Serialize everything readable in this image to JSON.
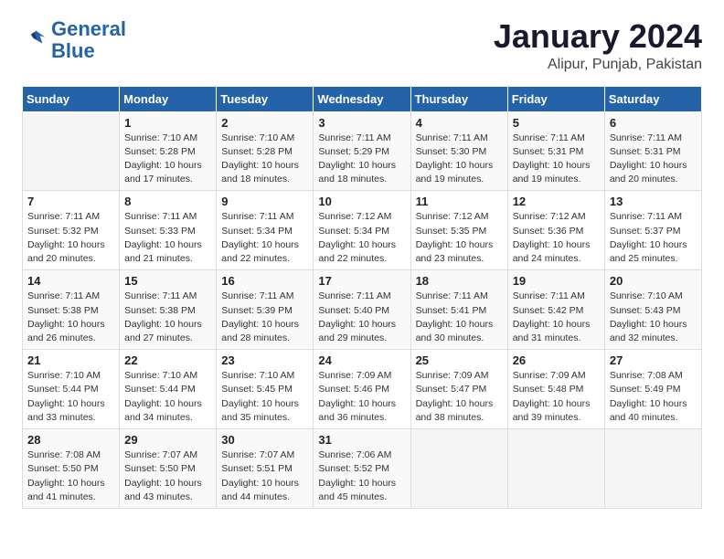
{
  "header": {
    "logo_line1": "General",
    "logo_line2": "Blue",
    "title": "January 2024",
    "subtitle": "Alipur, Punjab, Pakistan"
  },
  "weekdays": [
    "Sunday",
    "Monday",
    "Tuesday",
    "Wednesday",
    "Thursday",
    "Friday",
    "Saturday"
  ],
  "weeks": [
    [
      {
        "day": "",
        "sunrise": "",
        "sunset": "",
        "daylight": ""
      },
      {
        "day": "1",
        "sunrise": "Sunrise: 7:10 AM",
        "sunset": "Sunset: 5:28 PM",
        "daylight": "Daylight: 10 hours and 17 minutes."
      },
      {
        "day": "2",
        "sunrise": "Sunrise: 7:10 AM",
        "sunset": "Sunset: 5:28 PM",
        "daylight": "Daylight: 10 hours and 18 minutes."
      },
      {
        "day": "3",
        "sunrise": "Sunrise: 7:11 AM",
        "sunset": "Sunset: 5:29 PM",
        "daylight": "Daylight: 10 hours and 18 minutes."
      },
      {
        "day": "4",
        "sunrise": "Sunrise: 7:11 AM",
        "sunset": "Sunset: 5:30 PM",
        "daylight": "Daylight: 10 hours and 19 minutes."
      },
      {
        "day": "5",
        "sunrise": "Sunrise: 7:11 AM",
        "sunset": "Sunset: 5:31 PM",
        "daylight": "Daylight: 10 hours and 19 minutes."
      },
      {
        "day": "6",
        "sunrise": "Sunrise: 7:11 AM",
        "sunset": "Sunset: 5:31 PM",
        "daylight": "Daylight: 10 hours and 20 minutes."
      }
    ],
    [
      {
        "day": "7",
        "sunrise": "Sunrise: 7:11 AM",
        "sunset": "Sunset: 5:32 PM",
        "daylight": "Daylight: 10 hours and 20 minutes."
      },
      {
        "day": "8",
        "sunrise": "Sunrise: 7:11 AM",
        "sunset": "Sunset: 5:33 PM",
        "daylight": "Daylight: 10 hours and 21 minutes."
      },
      {
        "day": "9",
        "sunrise": "Sunrise: 7:11 AM",
        "sunset": "Sunset: 5:34 PM",
        "daylight": "Daylight: 10 hours and 22 minutes."
      },
      {
        "day": "10",
        "sunrise": "Sunrise: 7:12 AM",
        "sunset": "Sunset: 5:34 PM",
        "daylight": "Daylight: 10 hours and 22 minutes."
      },
      {
        "day": "11",
        "sunrise": "Sunrise: 7:12 AM",
        "sunset": "Sunset: 5:35 PM",
        "daylight": "Daylight: 10 hours and 23 minutes."
      },
      {
        "day": "12",
        "sunrise": "Sunrise: 7:12 AM",
        "sunset": "Sunset: 5:36 PM",
        "daylight": "Daylight: 10 hours and 24 minutes."
      },
      {
        "day": "13",
        "sunrise": "Sunrise: 7:11 AM",
        "sunset": "Sunset: 5:37 PM",
        "daylight": "Daylight: 10 hours and 25 minutes."
      }
    ],
    [
      {
        "day": "14",
        "sunrise": "Sunrise: 7:11 AM",
        "sunset": "Sunset: 5:38 PM",
        "daylight": "Daylight: 10 hours and 26 minutes."
      },
      {
        "day": "15",
        "sunrise": "Sunrise: 7:11 AM",
        "sunset": "Sunset: 5:38 PM",
        "daylight": "Daylight: 10 hours and 27 minutes."
      },
      {
        "day": "16",
        "sunrise": "Sunrise: 7:11 AM",
        "sunset": "Sunset: 5:39 PM",
        "daylight": "Daylight: 10 hours and 28 minutes."
      },
      {
        "day": "17",
        "sunrise": "Sunrise: 7:11 AM",
        "sunset": "Sunset: 5:40 PM",
        "daylight": "Daylight: 10 hours and 29 minutes."
      },
      {
        "day": "18",
        "sunrise": "Sunrise: 7:11 AM",
        "sunset": "Sunset: 5:41 PM",
        "daylight": "Daylight: 10 hours and 30 minutes."
      },
      {
        "day": "19",
        "sunrise": "Sunrise: 7:11 AM",
        "sunset": "Sunset: 5:42 PM",
        "daylight": "Daylight: 10 hours and 31 minutes."
      },
      {
        "day": "20",
        "sunrise": "Sunrise: 7:10 AM",
        "sunset": "Sunset: 5:43 PM",
        "daylight": "Daylight: 10 hours and 32 minutes."
      }
    ],
    [
      {
        "day": "21",
        "sunrise": "Sunrise: 7:10 AM",
        "sunset": "Sunset: 5:44 PM",
        "daylight": "Daylight: 10 hours and 33 minutes."
      },
      {
        "day": "22",
        "sunrise": "Sunrise: 7:10 AM",
        "sunset": "Sunset: 5:44 PM",
        "daylight": "Daylight: 10 hours and 34 minutes."
      },
      {
        "day": "23",
        "sunrise": "Sunrise: 7:10 AM",
        "sunset": "Sunset: 5:45 PM",
        "daylight": "Daylight: 10 hours and 35 minutes."
      },
      {
        "day": "24",
        "sunrise": "Sunrise: 7:09 AM",
        "sunset": "Sunset: 5:46 PM",
        "daylight": "Daylight: 10 hours and 36 minutes."
      },
      {
        "day": "25",
        "sunrise": "Sunrise: 7:09 AM",
        "sunset": "Sunset: 5:47 PM",
        "daylight": "Daylight: 10 hours and 38 minutes."
      },
      {
        "day": "26",
        "sunrise": "Sunrise: 7:09 AM",
        "sunset": "Sunset: 5:48 PM",
        "daylight": "Daylight: 10 hours and 39 minutes."
      },
      {
        "day": "27",
        "sunrise": "Sunrise: 7:08 AM",
        "sunset": "Sunset: 5:49 PM",
        "daylight": "Daylight: 10 hours and 40 minutes."
      }
    ],
    [
      {
        "day": "28",
        "sunrise": "Sunrise: 7:08 AM",
        "sunset": "Sunset: 5:50 PM",
        "daylight": "Daylight: 10 hours and 41 minutes."
      },
      {
        "day": "29",
        "sunrise": "Sunrise: 7:07 AM",
        "sunset": "Sunset: 5:50 PM",
        "daylight": "Daylight: 10 hours and 43 minutes."
      },
      {
        "day": "30",
        "sunrise": "Sunrise: 7:07 AM",
        "sunset": "Sunset: 5:51 PM",
        "daylight": "Daylight: 10 hours and 44 minutes."
      },
      {
        "day": "31",
        "sunrise": "Sunrise: 7:06 AM",
        "sunset": "Sunset: 5:52 PM",
        "daylight": "Daylight: 10 hours and 45 minutes."
      },
      {
        "day": "",
        "sunrise": "",
        "sunset": "",
        "daylight": ""
      },
      {
        "day": "",
        "sunrise": "",
        "sunset": "",
        "daylight": ""
      },
      {
        "day": "",
        "sunrise": "",
        "sunset": "",
        "daylight": ""
      }
    ]
  ]
}
